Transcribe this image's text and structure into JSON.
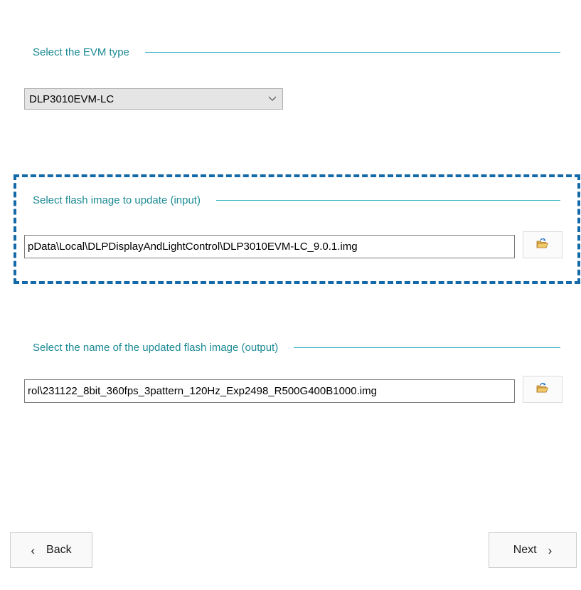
{
  "colors": {
    "section_title": "#1c8a94",
    "section_rule": "#2bb0c0",
    "highlight_border": "#1469a8"
  },
  "evm": {
    "section_title": "Select the EVM type",
    "selected": "DLP3010EVM-LC",
    "arrow_icon": "chevron-down-icon"
  },
  "input_image": {
    "section_title": "Select flash image to update (input)",
    "path": "pData\\Local\\DLPDisplayAndLightControl\\DLP3010EVM-LC_9.0.1.img",
    "browse_icon": "open-folder-icon"
  },
  "output_image": {
    "section_title": "Select the name of the updated flash image (output)",
    "path": "rol\\231122_8bit_360fps_3pattern_120Hz_Exp2498_R500G400B1000.img",
    "browse_icon": "open-folder-icon"
  },
  "nav": {
    "back_glyph": "‹",
    "back_label": "Back",
    "next_label": "Next",
    "next_glyph": "›"
  }
}
